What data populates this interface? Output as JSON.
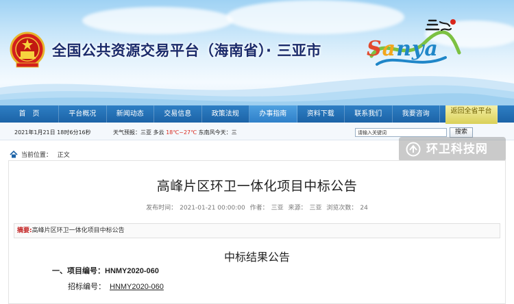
{
  "header": {
    "site_title": "全国公共资源交易平台（海南省）· 三亚市",
    "logo_text": "Sanya",
    "logo_chinese": "三亞"
  },
  "nav": {
    "items": [
      {
        "label": "首　页"
      },
      {
        "label": "平台概况"
      },
      {
        "label": "新闻动态"
      },
      {
        "label": "交易信息"
      },
      {
        "label": "政策法规"
      },
      {
        "label": "办事指南"
      },
      {
        "label": "资料下载"
      },
      {
        "label": "联系我们"
      },
      {
        "label": "我要咨询"
      }
    ],
    "active_index": 5,
    "return_label": "返回全省平台"
  },
  "infobar": {
    "date": "2021年1月21日 18时6分16秒",
    "weather_prefix": "天气预报：三亚 多云",
    "temperature": "18℃~27℃",
    "weather_suffix": "东南风今天：三",
    "search_placeholder": "请输入关键词",
    "search_button": "搜索"
  },
  "breadcrumb": {
    "label": "当前位置：",
    "current": "正文"
  },
  "watermark": {
    "text": "环卫科技网"
  },
  "article": {
    "title": "高峰片区环卫一体化项目中标公告",
    "meta": {
      "time_label": "发布时间：",
      "time_value": "2021-01-21 00:00:00",
      "author_label": "作者：",
      "author_value": "三亚",
      "source_label": "来源：",
      "source_value": "三亚",
      "views_label": "浏览次数：",
      "views_value": "24"
    },
    "summary_label": "摘要:",
    "summary_text": "高峰片区环卫一体化项目中标公告",
    "announce_title": "中标结果公告",
    "item1_label": "一、项目编号：",
    "item1_code": "HNMY2020-060",
    "tender_label": "招标编号：",
    "tender_code": "HNMY2020-060"
  },
  "colors": {
    "nav_blue": "#1c63a7",
    "nav_active": "#2f80c9",
    "return_yellow": "#d9cf55",
    "title_navy": "#1a2a6a",
    "summary_red": "#c21f1f",
    "temp_red": "#d9271c"
  }
}
